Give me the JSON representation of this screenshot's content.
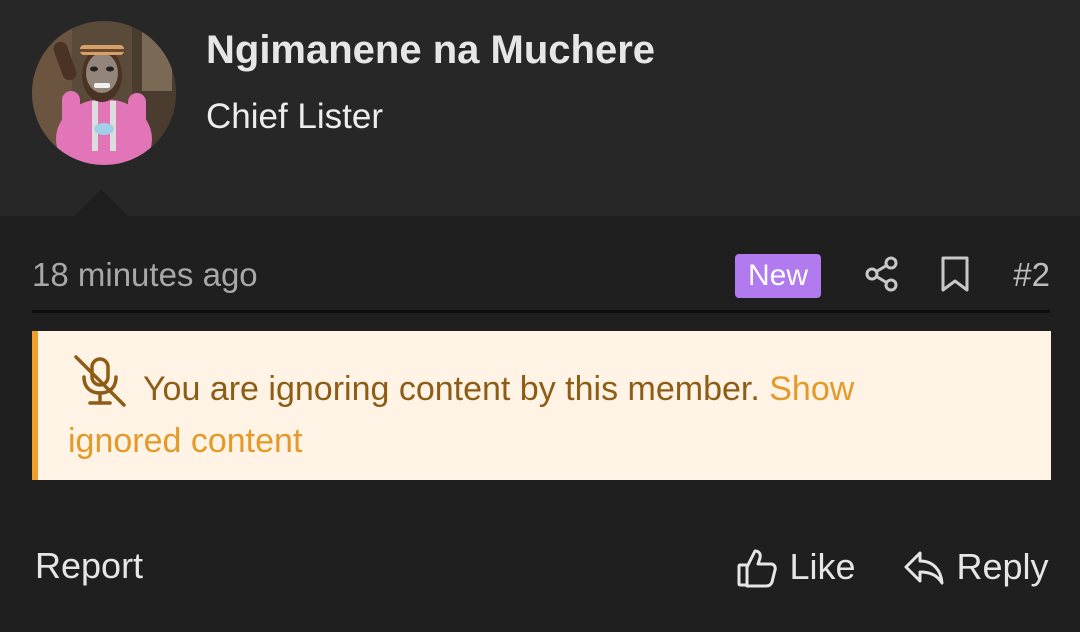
{
  "user": {
    "name": "Ngimanene na Muchere",
    "title": "Chief Lister"
  },
  "post": {
    "timestamp": "18 minutes ago",
    "badge": "New",
    "number": "#2"
  },
  "notice": {
    "message": "You are ignoring content by this member.",
    "link": "Show ignored content"
  },
  "actions": {
    "report": "Report",
    "like": "Like",
    "reply": "Reply"
  },
  "colors": {
    "badge": "#b17aee",
    "notice_bg": "#fef3e5",
    "notice_border": "#ef9f2a",
    "notice_text": "#8e5d15",
    "link": "#e49a28"
  }
}
